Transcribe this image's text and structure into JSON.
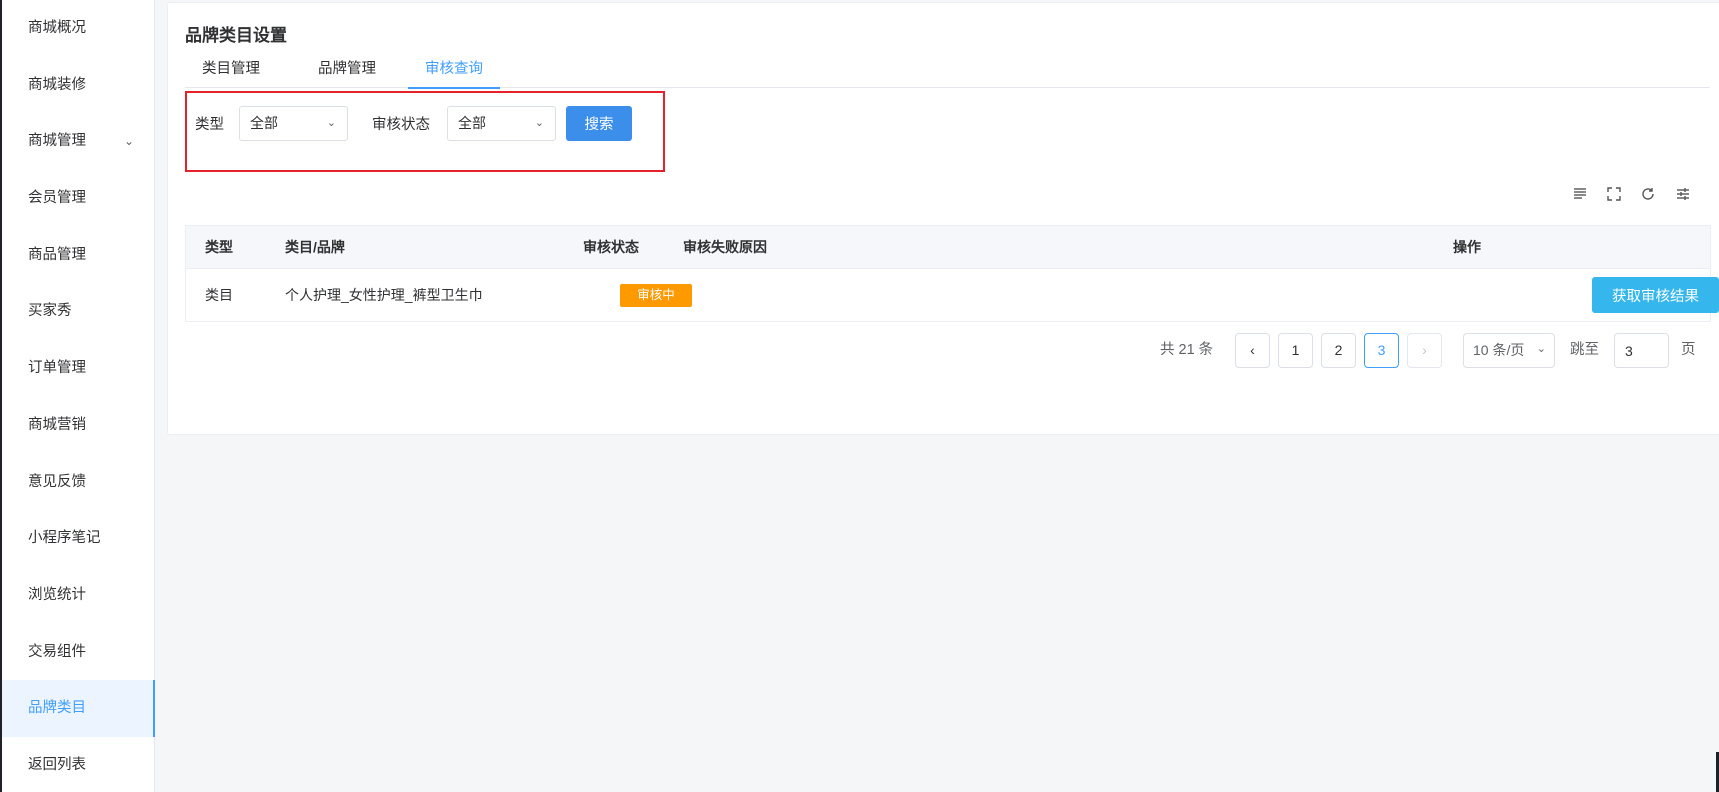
{
  "sidebar": {
    "items": [
      {
        "label": "商城概况"
      },
      {
        "label": "商城装修"
      },
      {
        "label": "商城管理"
      },
      {
        "label": "会员管理"
      },
      {
        "label": "商品管理"
      },
      {
        "label": "买家秀"
      },
      {
        "label": "订单管理"
      },
      {
        "label": "商城营销"
      },
      {
        "label": "意见反馈"
      },
      {
        "label": "小程序笔记"
      },
      {
        "label": "浏览统计"
      },
      {
        "label": "交易组件"
      },
      {
        "label": "品牌类目"
      },
      {
        "label": "返回列表"
      }
    ],
    "active": "品牌类目"
  },
  "page": {
    "title": "品牌类目设置",
    "tabs": [
      {
        "label": "类目管理"
      },
      {
        "label": "品牌管理"
      },
      {
        "label": "审核查询"
      }
    ],
    "active_tab": "审核查询"
  },
  "filters": {
    "type_label": "类型",
    "type_value": "全部",
    "status_label": "审核状态",
    "status_value": "全部",
    "search_label": "搜索"
  },
  "toolbar": {
    "icons": [
      "density-icon",
      "fullscreen-icon",
      "refresh-icon",
      "column-settings-icon"
    ]
  },
  "table": {
    "columns": [
      "类型",
      "类目/品牌",
      "审核状态",
      "审核失败原因",
      "操作"
    ],
    "rows": [
      {
        "type": "类目",
        "name": "个人护理_女性护理_裤型卫生巾",
        "status": "审核中",
        "reason": "",
        "action": "获取审核结果"
      }
    ]
  },
  "pagination": {
    "total_text": "共 21 条",
    "pages": [
      "1",
      "2",
      "3"
    ],
    "current_page": "3",
    "page_size": "10 条/页",
    "jump_label": "跳至",
    "jump_value": "3",
    "page_suffix": "页"
  },
  "colors": {
    "primary": "#3b8eea",
    "warning": "#ff9900",
    "info": "#35b6ec",
    "highlight": "#e5222b"
  }
}
